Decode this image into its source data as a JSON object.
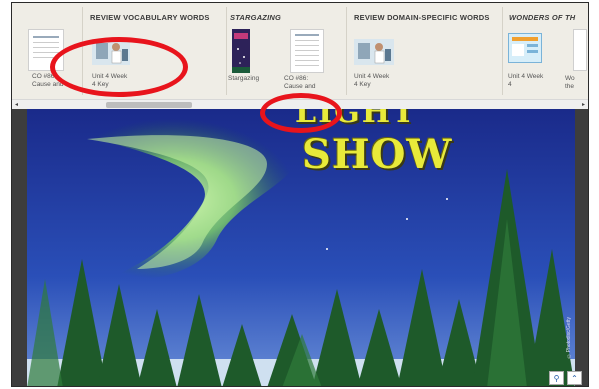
{
  "groups": [
    {
      "header": "REVIEW VOCABULARY WORDS",
      "italic": false
    },
    {
      "header": "STARGAZING",
      "italic": true
    },
    {
      "header": "REVIEW DOMAIN-SPECIFIC WORDS",
      "italic": false
    },
    {
      "header": "WONDERS OF TH",
      "italic": true
    }
  ],
  "items": [
    {
      "caption_line1": "CO #86:",
      "caption_line2": "Cause and"
    },
    {
      "caption_line1": "Unit 4 Week",
      "caption_line2": "4 Key"
    },
    {
      "caption_line1": "Stargazing",
      "caption_line2": ""
    },
    {
      "caption_line1": "CO #86:",
      "caption_line2": "Cause and"
    },
    {
      "caption_line1": "Unit 4 Week",
      "caption_line2": "4 Key"
    },
    {
      "caption_line1": "Unit 4 Week",
      "caption_line2": "4"
    },
    {
      "caption_line1": "Wo",
      "caption_line2": "the"
    }
  ],
  "scroll": {
    "left_arrow": "◂",
    "right_arrow": "▸"
  },
  "book": {
    "title_top": "LIGHT",
    "title": "SHOW",
    "credit": "©Photodisc/Getty"
  },
  "viewer_controls": {
    "zoom_icon": "⚲",
    "collapse_icon": "⌃"
  },
  "colors": {
    "annotation": "#e8141c",
    "title": "#e8ea3a",
    "header_text": "#3b3b3b"
  }
}
